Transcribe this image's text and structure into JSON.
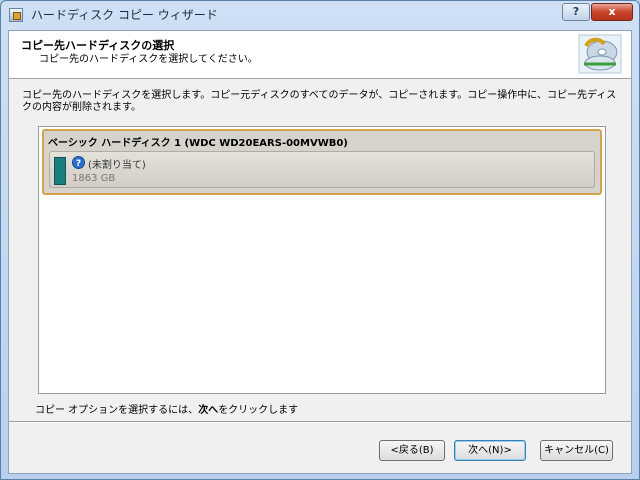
{
  "window": {
    "title": "ハードディスク コピー ウィザード",
    "help_label": "?",
    "close_label": "x"
  },
  "header": {
    "title": "コピー先ハードディスクの選択",
    "subtitle": "コピー先のハードディスクを選択してください。"
  },
  "description": "コピー先のハードディスクを選択します。コピー元ディスクのすべてのデータが、コピーされます。コピー操作中に、コピー先ディスクの内容が削除されます。",
  "disk": {
    "title": "ベーシック ハードディスク 1 (WDC WD20EARS-00MVWB0)",
    "partition": {
      "label": "(未割り当て)",
      "size": "1863 GB",
      "color": "#197f80"
    }
  },
  "hint": {
    "before": "コピー オプションを選択するには、",
    "emphasis": "次へ",
    "after": "をクリックします"
  },
  "buttons": {
    "back": "<戻る(B)",
    "next": "次へ(N)>",
    "cancel": "キャンセル(C)"
  }
}
